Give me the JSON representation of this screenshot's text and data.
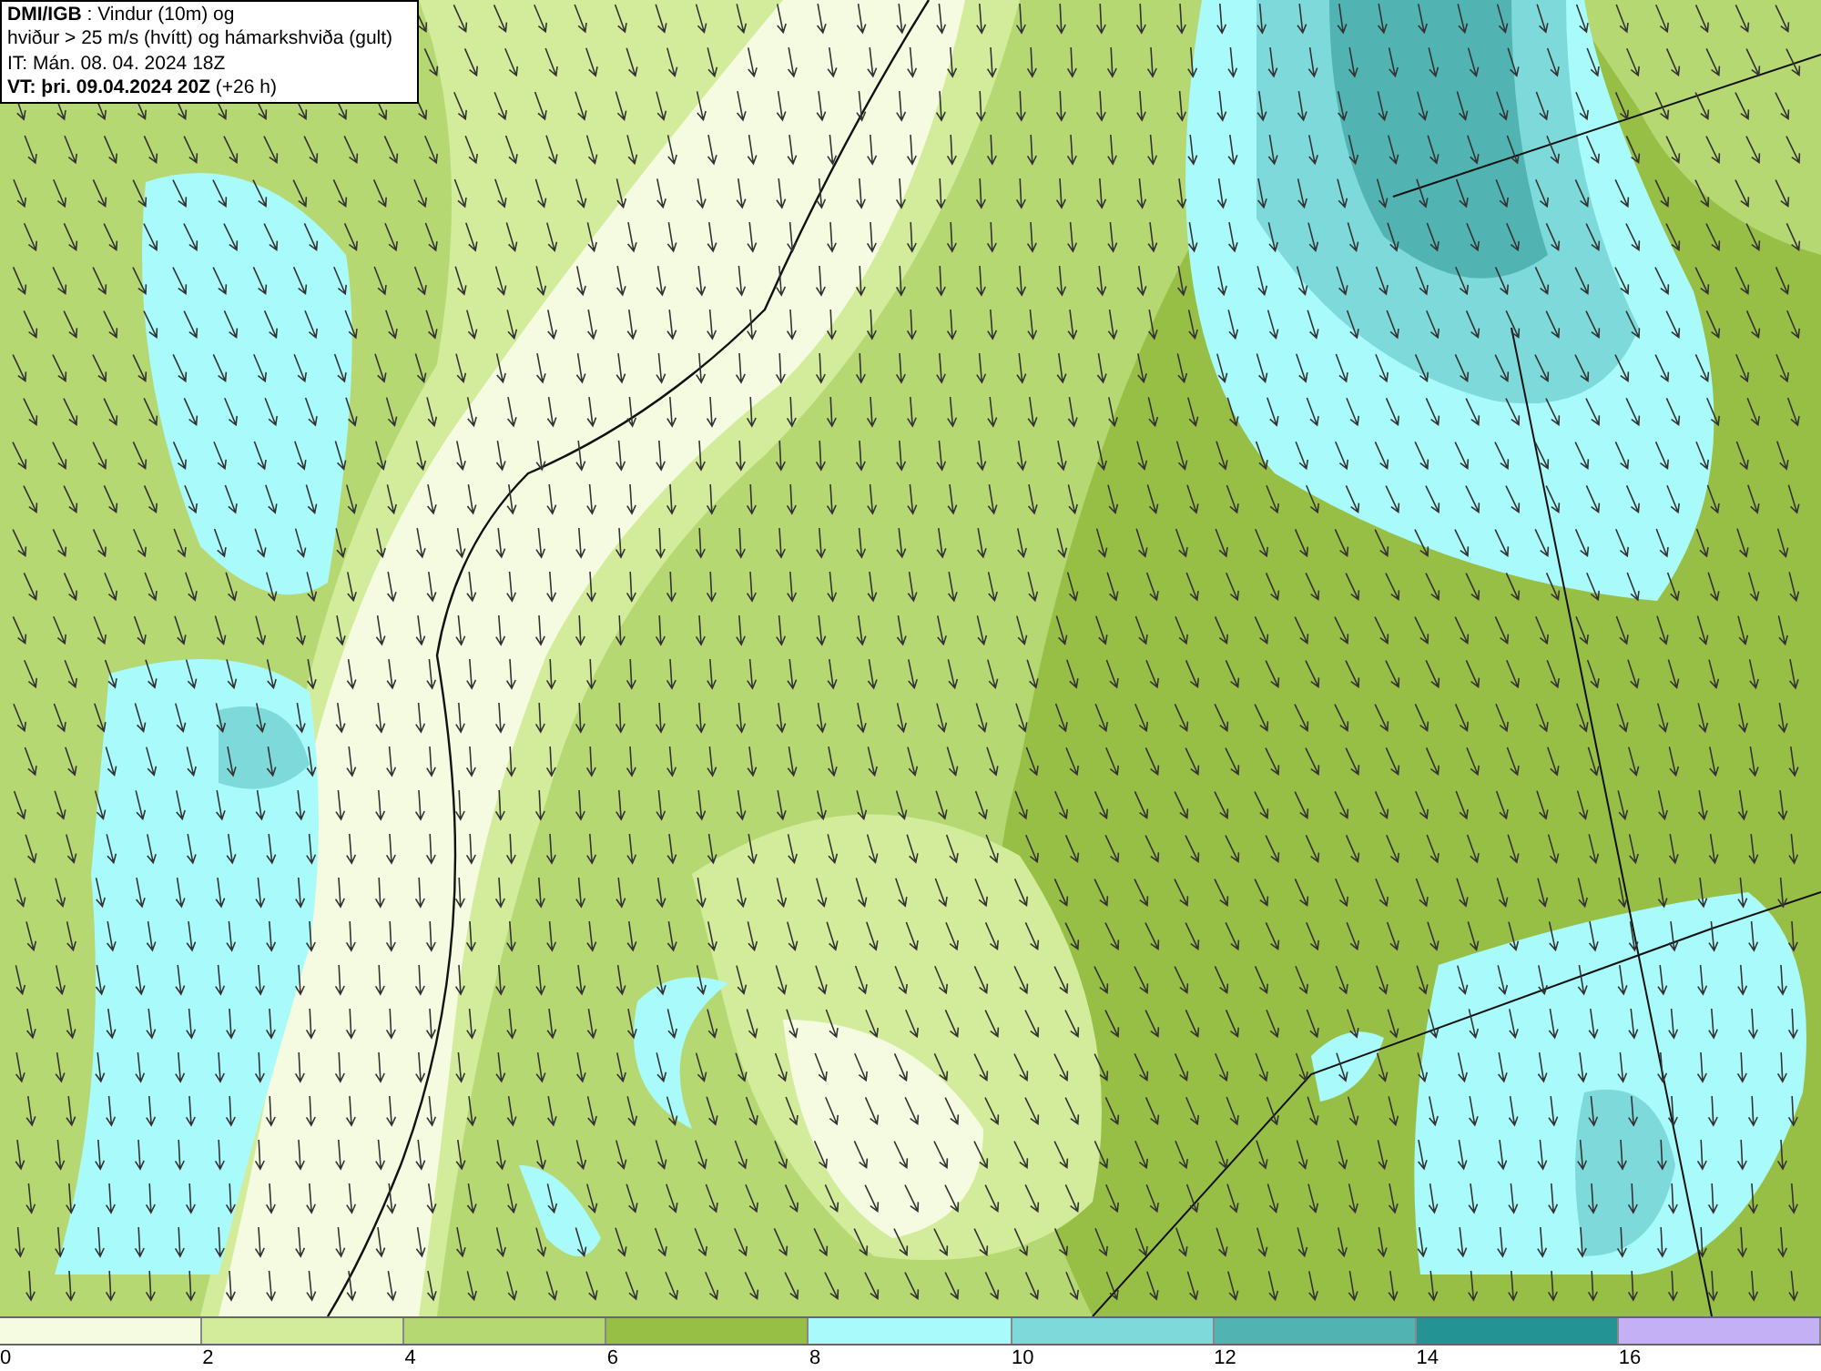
{
  "title_box": {
    "lines": [
      "**DMI/IGB** : Vindur (10m) og",
      "hviður > 25 m/s (hvítt) og hámarkshviða (gult)",
      "IT: Mán. 08. 04. 2024 18Z",
      "**VT: þri. 09.04.2024 20Z** (+26 h)"
    ]
  },
  "legend": {
    "bins": [
      {
        "color": "#f5fbe0"
      },
      {
        "color": "#d3ec9b"
      },
      {
        "color": "#b5d873"
      },
      {
        "color": "#98bf45"
      },
      {
        "color": "#a9fafa"
      },
      {
        "color": "#7edada"
      },
      {
        "color": "#52b3b3"
      },
      {
        "color": "#239393"
      },
      {
        "color": "#c3b0f5"
      }
    ],
    "ticks": [
      "0",
      "2",
      "4",
      "6",
      "8",
      "10",
      "12",
      "14",
      "16"
    ]
  }
}
